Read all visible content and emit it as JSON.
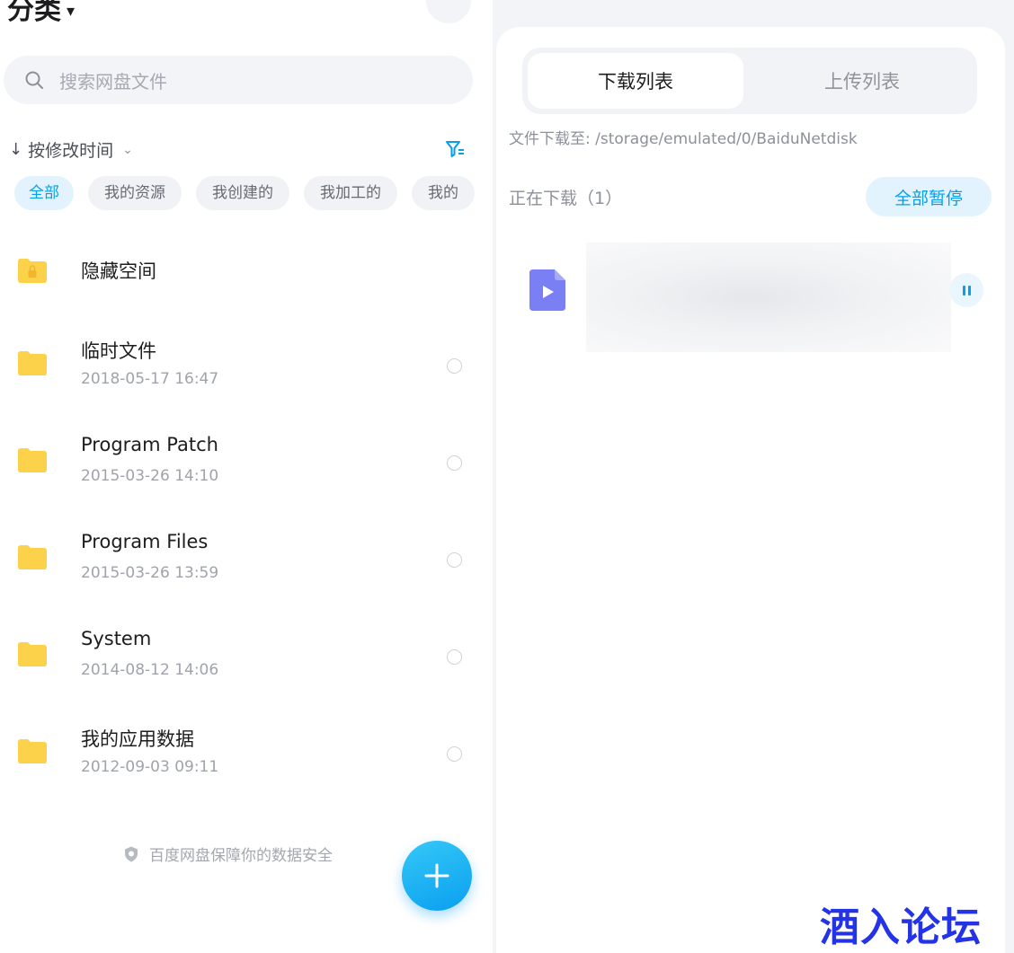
{
  "left": {
    "title": "分类",
    "more_label": "···",
    "search_placeholder": "搜索网盘文件",
    "sort_label": "按修改时间",
    "chips": [
      "全部",
      "我的资源",
      "我创建的",
      "我加工的",
      "我的"
    ],
    "files": [
      {
        "name": "隐藏空间",
        "date": ""
      },
      {
        "name": "临时文件",
        "date": "2018-05-17  16:47"
      },
      {
        "name": "Program Patch",
        "date": "2015-03-26  14:10"
      },
      {
        "name": "Program Files",
        "date": "2015-03-26  13:59"
      },
      {
        "name": "System",
        "date": "2014-08-12  14:06"
      },
      {
        "name": "我的应用数据",
        "date": "2012-09-03  09:11"
      }
    ],
    "safety_note": "百度网盘保障你的数据安全"
  },
  "right": {
    "tabs": {
      "active": "下载列表",
      "inactive": "上传列表"
    },
    "download_path": "文件下载至: /storage/emulated/0/BaiduNetdisk",
    "downloading_label": "正在下载（1）",
    "pause_all_label": "全部暂停"
  },
  "watermark": "酒入论坛",
  "colors": {
    "accent": "#089ee8",
    "folder": "#fdd24b",
    "video_icon": "#7b7ff4",
    "watermark": "#2433e6"
  },
  "icons": [
    "search-icon",
    "filter-icon",
    "folder-icon",
    "lock-folder-icon",
    "shield-icon",
    "plus-icon",
    "video-file-icon",
    "pause-icon"
  ]
}
